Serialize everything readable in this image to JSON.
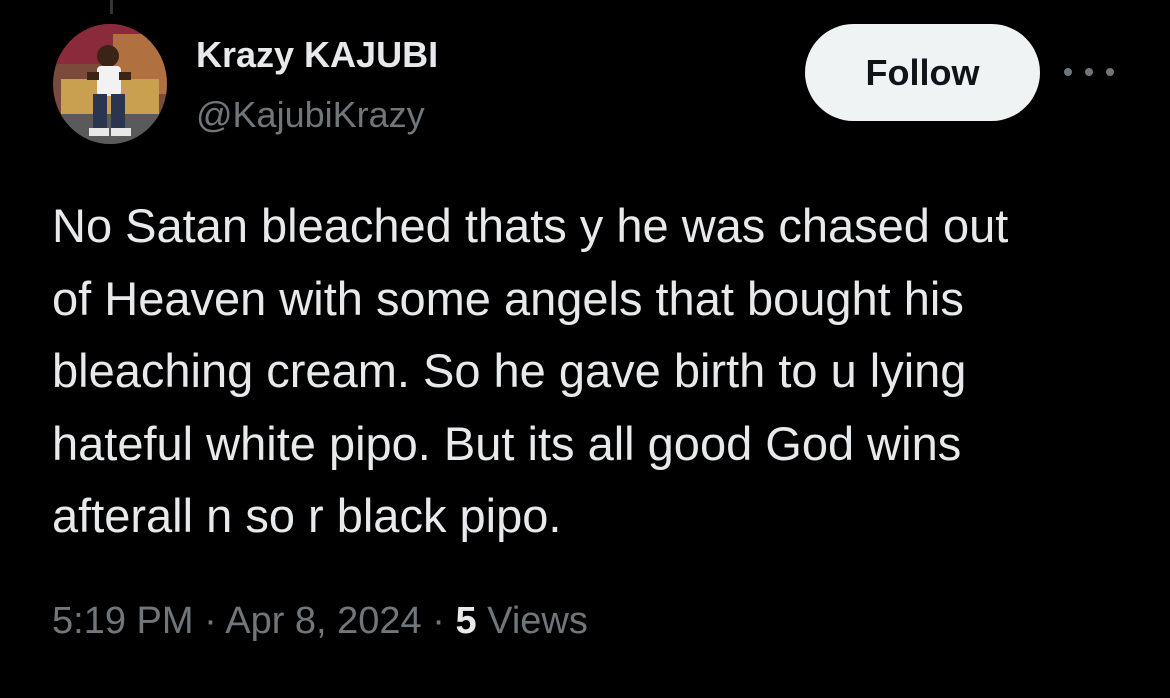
{
  "user": {
    "display_name": "Krazy KAJUBI",
    "handle": "@KajubiKrazy",
    "avatar_icon": "profile-photo"
  },
  "follow_button": {
    "label": "Follow"
  },
  "more_menu": {
    "icon": "more-horizontal-icon"
  },
  "tweet": {
    "text": "No Satan bleached thats y he was chased out\nof Heaven with some angels that bought his\nbleaching cream. So he gave birth to u lying\nhateful white pipo. But its all good God wins\nafterall n so r black pipo."
  },
  "meta": {
    "time": "5:19 PM",
    "sep1": " · ",
    "date": "Apr 8, 2024",
    "sep2": " · ",
    "views_count": "5",
    "views_label": " Views"
  },
  "colors": {
    "background": "#000000",
    "primary_text": "#e7e9ea",
    "secondary_text": "#71767b",
    "button_bg": "#eff3f4",
    "button_text": "#0f1419"
  }
}
